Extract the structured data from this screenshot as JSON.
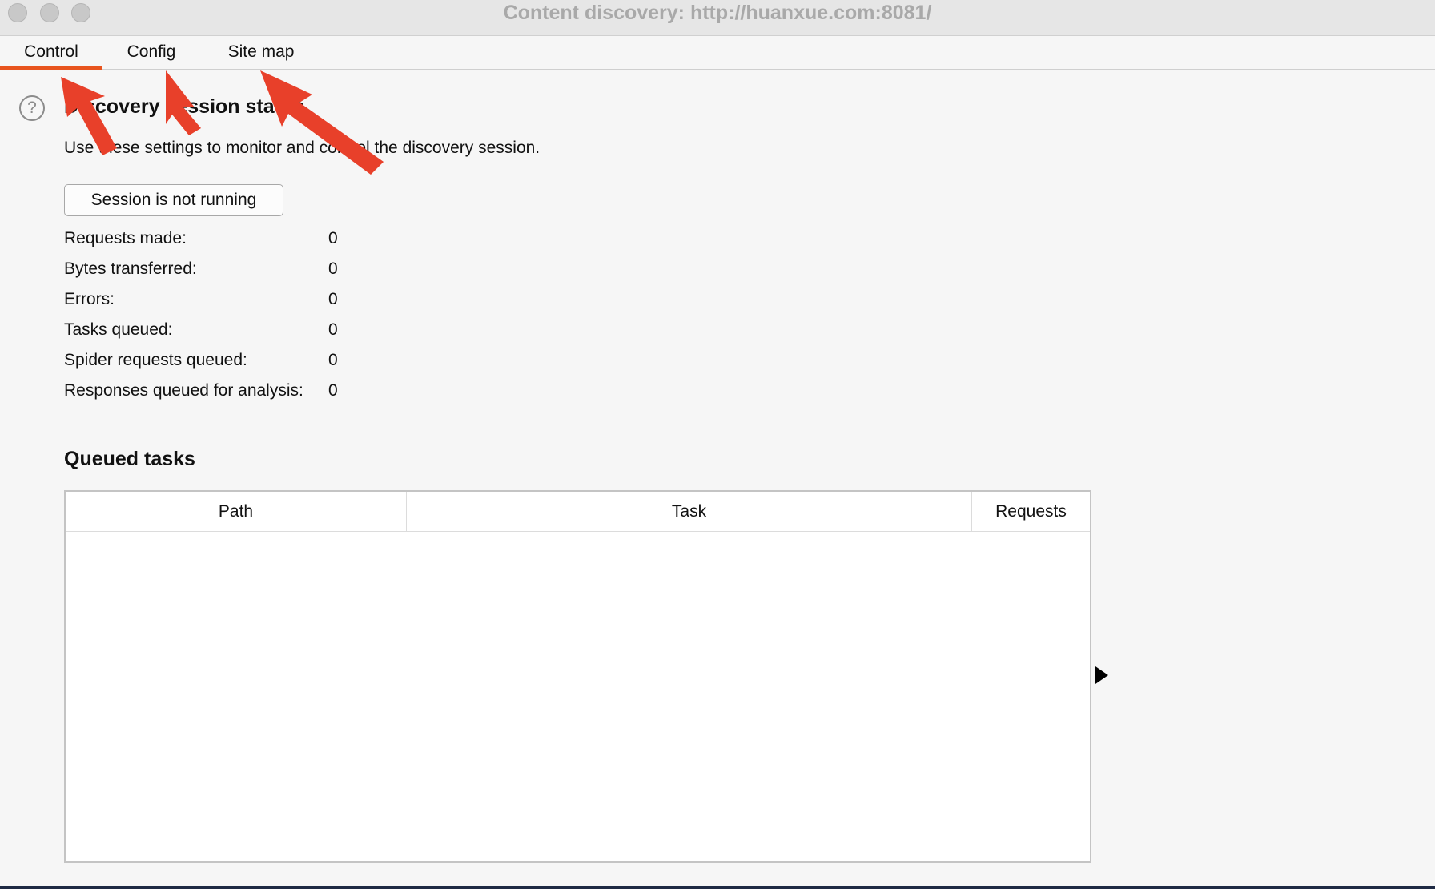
{
  "window": {
    "title": "Content discovery: http://huanxue.com:8081/"
  },
  "tabs": [
    {
      "label": "Control",
      "active": true
    },
    {
      "label": "Config",
      "active": false
    },
    {
      "label": "Site map",
      "active": false
    }
  ],
  "control": {
    "help_icon_glyph": "?",
    "status_heading": "Discovery session status",
    "description": "Use these settings to monitor and control the discovery session.",
    "session_button_label": "Session is not running",
    "stats": [
      {
        "label": "Requests made:",
        "value": "0"
      },
      {
        "label": "Bytes transferred:",
        "value": "0"
      },
      {
        "label": "Errors:",
        "value": "0"
      },
      {
        "label": "Tasks queued:",
        "value": "0"
      },
      {
        "label": "Spider requests queued:",
        "value": "0"
      },
      {
        "label": "Responses queued for analysis:",
        "value": "0"
      }
    ],
    "queued_tasks_heading": "Queued tasks",
    "queued_tasks_table": {
      "columns": [
        "Path",
        "Task",
        "Requests"
      ],
      "rows": []
    }
  },
  "colors": {
    "accent": "#e8541e",
    "annotation_arrow": "#e8402a"
  },
  "icons": {
    "help": "help-circle-icon",
    "expand": "triangle-right-icon"
  }
}
